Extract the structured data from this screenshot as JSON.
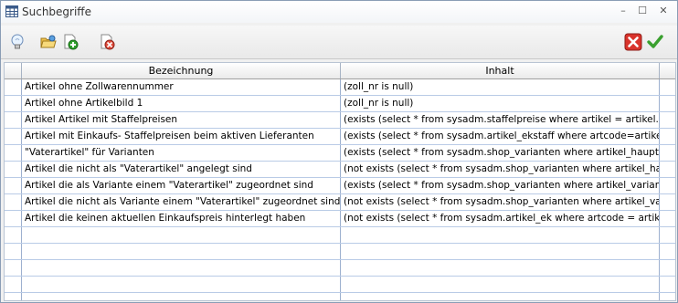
{
  "window": {
    "title": "Suchbegriffe",
    "controls": {
      "minimize": "–",
      "maximize": "☐",
      "close": "✕"
    }
  },
  "toolbar": {
    "left_icons": [
      "lightbulb-icon",
      "folder-open-icon",
      "add-document-icon",
      "delete-document-icon"
    ],
    "right_icons": [
      "cancel-icon",
      "confirm-icon"
    ],
    "colors": {
      "cancel": "#d9332b",
      "confirm": "#3aa02f",
      "add": "#2fa02c"
    }
  },
  "grid": {
    "columns": [
      "Bezeichnung",
      "Inhalt"
    ],
    "rows": [
      {
        "bezeichnung": "Artikel ohne Zollwarennummer",
        "inhalt": "(zoll_nr is null)"
      },
      {
        "bezeichnung": "Artikel ohne Artikelbild 1",
        "inhalt": "(zoll_nr is null)"
      },
      {
        "bezeichnung": "Artikel Artikel mit Staffelpreisen",
        "inhalt": "(exists (select * from sysadm.staffelpreise where artikel = artikel.artcode))"
      },
      {
        "bezeichnung": "Artikel mit Einkaufs- Staffelpreisen beim aktiven Lieferanten",
        "inhalt": "(exists (select * from sysadm.artikel_ekstaff where artcode=artikel.artcode"
      },
      {
        "bezeichnung": "\"Vaterartikel\" für Varianten",
        "inhalt": "(exists (select * from sysadm.shop_varianten where artikel_haupt = artikel"
      },
      {
        "bezeichnung": "Artikel die nicht als \"Vaterartikel\" angelegt sind",
        "inhalt": "(not exists (select * from sysadm.shop_varianten where artikel_haupt = a"
      },
      {
        "bezeichnung": "Artikel die als Variante einem \"Vaterartikel\" zugeordnet sind",
        "inhalt": "(exists (select * from sysadm.shop_varianten where artikel_variante = art"
      },
      {
        "bezeichnung": "Artikel die nicht als Variante einem \"Vaterartikel\" zugeordnet sind",
        "inhalt": "(not exists (select * from sysadm.shop_varianten where artikel_variante"
      },
      {
        "bezeichnung": "Artikel die keinen aktuellen Einkaufspreis hinterlegt haben",
        "inhalt": "(not exists (select * from sysadm.artikel_ek where artcode = artikel.artco"
      },
      {
        "bezeichnung": "",
        "inhalt": ""
      },
      {
        "bezeichnung": "",
        "inhalt": ""
      },
      {
        "bezeichnung": "",
        "inhalt": ""
      },
      {
        "bezeichnung": "",
        "inhalt": ""
      },
      {
        "bezeichnung": "",
        "inhalt": ""
      }
    ]
  }
}
